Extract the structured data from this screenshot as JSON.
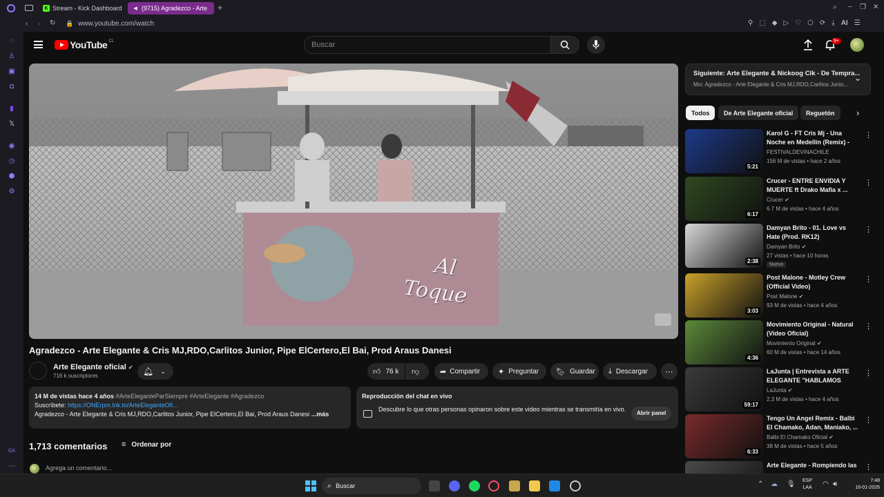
{
  "browser": {
    "tabs": [
      {
        "label": "Stream - Kick Dashboard",
        "active": false
      },
      {
        "label": "(9715) Agradezco - Arte",
        "active": true
      }
    ],
    "url": "www.youtube.com/watch",
    "ai_label": "AI"
  },
  "yt": {
    "logo": "YouTube",
    "region": "CL",
    "search_placeholder": "Buscar",
    "notif_count": "9+"
  },
  "video": {
    "title": "Agradezco - Arte Elegante & Cris MJ,RDO,Carlitos Junior, Pipe ElCertero,El Bai, Prod Araus Danesi",
    "channel": "Arte Elegante oficial",
    "subscribers": "716 k suscriptores",
    "likes": "76 k",
    "share": "Compartir",
    "ask": "Preguntar",
    "save": "Guardar",
    "download": "Descargar",
    "overlay_text_line1": "Al",
    "overlay_text_line2": "Toque"
  },
  "description": {
    "stats": "14 M de vistas  hace 4 años",
    "hashtags": " #ArteEleganteParSiempre #ArteElegante #Agradezco",
    "subscribe_label": "Suscríbete: ",
    "link": "https://ONErpm.lnk.to/ArteEleganteOfi...",
    "text": "Agradezco - Arte Elegante & Cris MJ,RDO,Carlitos Junior, Pipe ElCertero,El Bai, Prod Araus Danesi",
    "more": "...más"
  },
  "chat_replay": {
    "title": "Reproducción del chat en vivo",
    "text": "Descubre lo que otras personas opinaron sobre este video mientras se transmitía en vivo.",
    "button": "Abrir panel"
  },
  "comments": {
    "count": "1,713 comentarios",
    "sort": "Ordenar por",
    "placeholder": "Agrega un comentario..."
  },
  "up_next": {
    "title": "Siguiente: Arte Elegante & Nickoog Clk - De Tempra...",
    "sub": "Mix: Agradezco - Arte Elegante & Cris MJ,RDO,Carlitos Junio..."
  },
  "chips": [
    "Todos",
    "De Arte Elegante oficial",
    "Reguetón"
  ],
  "recommendations": [
    {
      "title": "Karol G - FT Cris Mj - Una Noche en Medellín (Remix) - Festival ...",
      "channel": "FESTIVALDEVINACHILE",
      "meta": "156 M de vistas • hace 2 años",
      "duration": "5:21",
      "verified": false,
      "badge": "",
      "color": "#1d3a8a"
    },
    {
      "title": "Crucer - ENTRE ENVIDIA Y MUERTE ft Drako Mafia x ...",
      "channel": "Crucer",
      "meta": "6.7 M de vistas • hace 4 años",
      "duration": "6:17",
      "verified": true,
      "badge": "",
      "color": "#2f4a1f"
    },
    {
      "title": "Damyan Brito - 01. Love vs Hate (Prod. RK12)",
      "channel": "Damyan Brito",
      "meta": "27 vistas • hace 10 horas",
      "duration": "2:38",
      "verified": true,
      "badge": "Nuevo",
      "color": "#d8d8d8"
    },
    {
      "title": "Post Malone - Motley Crew (Official Video)",
      "channel": "Post Malone",
      "meta": "93 M de vistas • hace 4 años",
      "duration": "3:03",
      "verified": true,
      "badge": "",
      "color": "#c9a02a"
    },
    {
      "title": "Movimiento Original - Natural (Video Oficial)",
      "channel": "Movimiento Original",
      "meta": "60 M de vistas • hace 14 años",
      "duration": "4:36",
      "verified": true,
      "badge": "",
      "color": "#5b8a3a"
    },
    {
      "title": "LaJunta | Entrevista a ARTE ELEGANTE \"HABLAMOS POC...",
      "channel": "LaJunta",
      "meta": "2.3 M de vistas • hace 4 años",
      "duration": "59:17",
      "verified": true,
      "badge": "",
      "color": "#3a3a3a"
    },
    {
      "title": "Tengo Un Angel Remix - Balbi El Chamako, Adan, Maniako, ...",
      "channel": "Balbi El Chamako Oficial",
      "meta": "38 M de vistas • hace 5 años",
      "duration": "6:33",
      "verified": true,
      "badge": "",
      "color": "#7a2a2a"
    },
    {
      "title": "Arte Elegante - Rompiendo las",
      "channel": "",
      "meta": "",
      "duration": "",
      "verified": false,
      "badge": "",
      "color": "#4a4a4a"
    }
  ],
  "taskbar": {
    "search": "Buscar",
    "lang1": "ESP",
    "lang2": "LAA",
    "time": "7:48",
    "date": "16-01-2026"
  },
  "colors": {
    "yt_red": "#ff0000",
    "opera_purple": "#7a2b8c",
    "link_blue": "#3ea6ff"
  }
}
